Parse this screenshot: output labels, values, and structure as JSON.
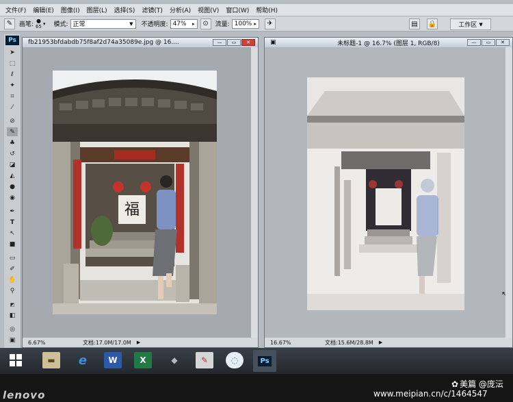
{
  "menubar": {
    "items": [
      "文件(F)",
      "编辑(E)",
      "图像(I)",
      "图层(L)",
      "选择(S)",
      "滤镜(T)",
      "分析(A)",
      "视图(V)",
      "窗口(W)",
      "帮助(H)"
    ]
  },
  "options": {
    "brush_label": "画笔:",
    "brush_size": "65",
    "mode_label": "模式:",
    "mode_value": "正常",
    "opacity_label": "不透明度:",
    "opacity_value": "47%",
    "flow_label": "流量:",
    "flow_value": "100%",
    "workspace_label": "工作区"
  },
  "tools": {
    "logo": "Ps"
  },
  "doc_left": {
    "title": "fb21953bfdabdb75f8af2d74a35089e.jpg @ 16....",
    "zoom": "6.67%",
    "doc_info": "文档:17.0M/17.0M"
  },
  "doc_right": {
    "title": "未标题-1 @ 16.7% (图层 1, RGB/8)",
    "zoom": "16.67%",
    "doc_info": "文档:15.6M/28.8M"
  },
  "taskbar": {
    "ps_label": "Ps"
  },
  "bezel": {
    "brand": "lenovo",
    "watermark_name": "美篇 @庞沄",
    "watermark_url": "www.meipian.cn/c/1464547"
  }
}
